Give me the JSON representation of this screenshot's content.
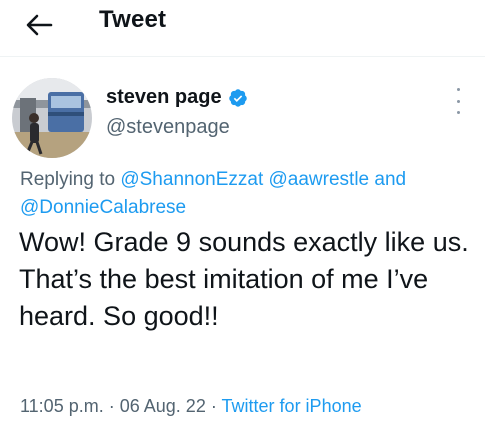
{
  "header": {
    "title": "Tweet",
    "back_icon": "arrow-left-icon"
  },
  "tweet": {
    "author": {
      "display_name": "steven page",
      "handle": "@stevenpage",
      "verified": true,
      "verified_color": "#1d9bf0"
    },
    "reply_context": {
      "prefix": "Replying to",
      "mentions": [
        "@ShannonEzzat",
        "@aawrestle",
        "@DonnieCalabrese"
      ],
      "conjunction": "and"
    },
    "text": "Wow! Grade 9 sounds exactly like us. That’s the best imitation of me I’ve heard. So good!!",
    "time": "11:05 p.m.",
    "separator": "·",
    "date": "06 Aug. 22",
    "source": "Twitter for iPhone"
  },
  "colors": {
    "link": "#1d9bf0",
    "secondary_text": "#536471",
    "primary_text": "#0f1419"
  }
}
